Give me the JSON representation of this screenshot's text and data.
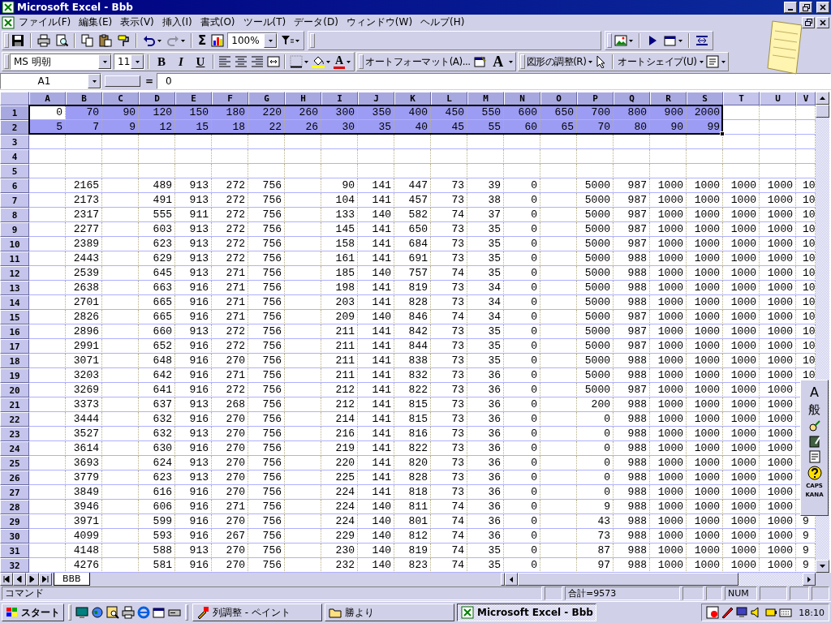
{
  "window": {
    "title": "Microsoft Excel - Bbb"
  },
  "menu_bar": {
    "items": [
      "ファイル(F)",
      "編集(E)",
      "表示(V)",
      "挿入(I)",
      "書式(O)",
      "ツール(T)",
      "データ(D)",
      "ウィンドウ(W)",
      "ヘルプ(H)"
    ]
  },
  "standard_toolbar": {
    "autosum": "Σ",
    "zoom": "100%",
    "redo": {
      "disabled": true
    }
  },
  "formatting_toolbar": {
    "font": "MS 明朝",
    "size": "11",
    "bold": "B",
    "italic": "I",
    "underline": "U",
    "font_color": "A",
    "autoformat": "オートフォーマット(A)...",
    "grow_font": "A",
    "draw": "図形の調整(R)",
    "autoshapes": "オートシェイプ(U)"
  },
  "formula_bar": {
    "name_box": "A1",
    "equals": "=",
    "value": "0"
  },
  "grid": {
    "columns": [
      "A",
      "B",
      "C",
      "D",
      "E",
      "F",
      "G",
      "H",
      "I",
      "J",
      "K",
      "L",
      "M",
      "N",
      "O",
      "P",
      "Q",
      "R",
      "S",
      "T",
      "U",
      "V"
    ],
    "rows": [
      {
        "label": "1",
        "cells": [
          {
            "value": "0",
            "selected": true,
            "active": true
          },
          {
            "value": "70",
            "selected": true,
            "active": false
          },
          {
            "value": "90",
            "selected": true,
            "active": false
          },
          {
            "value": "120",
            "selected": true,
            "active": false
          },
          {
            "value": "150",
            "selected": true,
            "active": false
          },
          {
            "value": "180",
            "selected": true,
            "active": false
          },
          {
            "value": "220",
            "selected": true,
            "active": false
          },
          {
            "value": "260",
            "selected": true,
            "active": false
          },
          {
            "value": "300",
            "selected": true,
            "active": false
          },
          {
            "value": "350",
            "selected": true,
            "active": false
          },
          {
            "value": "400",
            "selected": true,
            "active": false
          },
          {
            "value": "450",
            "selected": true,
            "active": false
          },
          {
            "value": "550",
            "selected": true,
            "active": false
          },
          {
            "value": "600",
            "selected": true,
            "active": false
          },
          {
            "value": "650",
            "selected": true,
            "active": false
          },
          {
            "value": "700",
            "selected": true,
            "active": false
          },
          {
            "value": "800",
            "selected": true,
            "active": false
          },
          {
            "value": "900",
            "selected": true,
            "active": false
          },
          {
            "value": "2000",
            "selected": true,
            "active": false
          }
        ]
      },
      {
        "label": "2",
        "cells": [
          {
            "value": "5",
            "selected": true,
            "active": false
          },
          {
            "value": "7",
            "selected": true,
            "active": false
          },
          {
            "value": "9",
            "selected": true,
            "active": false
          },
          {
            "value": "12",
            "selected": true,
            "active": false
          },
          {
            "value": "15",
            "selected": true,
            "active": false
          },
          {
            "value": "18",
            "selected": true,
            "active": false
          },
          {
            "value": "22",
            "selected": true,
            "active": false
          },
          {
            "value": "26",
            "selected": true,
            "active": false
          },
          {
            "value": "30",
            "selected": true,
            "active": false
          },
          {
            "value": "35",
            "selected": true,
            "active": false
          },
          {
            "value": "40",
            "selected": true,
            "active": false
          },
          {
            "value": "45",
            "selected": true,
            "active": false
          },
          {
            "value": "55",
            "selected": true,
            "active": false
          },
          {
            "value": "60",
            "selected": true,
            "active": false
          },
          {
            "value": "65",
            "selected": true,
            "active": false
          },
          {
            "value": "70",
            "selected": true,
            "active": false
          },
          {
            "value": "80",
            "selected": true,
            "active": false
          },
          {
            "value": "90",
            "selected": true,
            "active": false
          },
          {
            "value": "99",
            "selected": true,
            "active": false
          }
        ]
      },
      {
        "label": "3"
      },
      {
        "label": "4"
      },
      {
        "label": "5"
      },
      {
        "label": "6",
        "cells": [
          null,
          "2165",
          null,
          "489",
          "913",
          "272",
          "756",
          null,
          "90",
          "141",
          "447",
          "73",
          "39",
          "0",
          null,
          "5000",
          "987",
          "1000",
          "1000",
          "1000",
          "1000",
          "10"
        ]
      },
      {
        "label": "7",
        "cells": [
          null,
          "2173",
          null,
          "491",
          "913",
          "272",
          "756",
          null,
          "104",
          "141",
          "457",
          "73",
          "38",
          "0",
          null,
          "5000",
          "987",
          "1000",
          "1000",
          "1000",
          "1000",
          "10"
        ]
      },
      {
        "label": "8",
        "cells": [
          null,
          "2317",
          null,
          "555",
          "911",
          "272",
          "756",
          null,
          "133",
          "140",
          "582",
          "74",
          "37",
          "0",
          null,
          "5000",
          "987",
          "1000",
          "1000",
          "1000",
          "1000",
          "10"
        ]
      },
      {
        "label": "9",
        "cells": [
          null,
          "2277",
          null,
          "603",
          "913",
          "272",
          "756",
          null,
          "145",
          "141",
          "650",
          "73",
          "35",
          "0",
          null,
          "5000",
          "987",
          "1000",
          "1000",
          "1000",
          "1000",
          "10"
        ]
      },
      {
        "label": "10",
        "cells": [
          null,
          "2389",
          null,
          "623",
          "913",
          "272",
          "756",
          null,
          "158",
          "141",
          "684",
          "73",
          "35",
          "0",
          null,
          "5000",
          "987",
          "1000",
          "1000",
          "1000",
          "1000",
          "10"
        ]
      },
      {
        "label": "11",
        "cells": [
          null,
          "2443",
          null,
          "629",
          "913",
          "272",
          "756",
          null,
          "161",
          "141",
          "691",
          "73",
          "35",
          "0",
          null,
          "5000",
          "988",
          "1000",
          "1000",
          "1000",
          "1000",
          "10"
        ]
      },
      {
        "label": "12",
        "cells": [
          null,
          "2539",
          null,
          "645",
          "913",
          "271",
          "756",
          null,
          "185",
          "140",
          "757",
          "74",
          "35",
          "0",
          null,
          "5000",
          "988",
          "1000",
          "1000",
          "1000",
          "1000",
          "10"
        ]
      },
      {
        "label": "13",
        "cells": [
          null,
          "2638",
          null,
          "663",
          "916",
          "271",
          "756",
          null,
          "198",
          "141",
          "819",
          "73",
          "34",
          "0",
          null,
          "5000",
          "988",
          "1000",
          "1000",
          "1000",
          "1000",
          "10"
        ]
      },
      {
        "label": "14",
        "cells": [
          null,
          "2701",
          null,
          "665",
          "916",
          "271",
          "756",
          null,
          "203",
          "141",
          "828",
          "73",
          "34",
          "0",
          null,
          "5000",
          "988",
          "1000",
          "1000",
          "1000",
          "1000",
          "10"
        ]
      },
      {
        "label": "15",
        "cells": [
          null,
          "2826",
          null,
          "665",
          "916",
          "271",
          "756",
          null,
          "209",
          "140",
          "846",
          "74",
          "34",
          "0",
          null,
          "5000",
          "987",
          "1000",
          "1000",
          "1000",
          "1000",
          "10"
        ]
      },
      {
        "label": "16",
        "cells": [
          null,
          "2896",
          null,
          "660",
          "913",
          "272",
          "756",
          null,
          "211",
          "141",
          "842",
          "73",
          "35",
          "0",
          null,
          "5000",
          "987",
          "1000",
          "1000",
          "1000",
          "1000",
          "10"
        ]
      },
      {
        "label": "17",
        "cells": [
          null,
          "2991",
          null,
          "652",
          "916",
          "272",
          "756",
          null,
          "211",
          "141",
          "844",
          "73",
          "35",
          "0",
          null,
          "5000",
          "987",
          "1000",
          "1000",
          "1000",
          "1000",
          "10"
        ]
      },
      {
        "label": "18",
        "cells": [
          null,
          "3071",
          null,
          "648",
          "916",
          "270",
          "756",
          null,
          "211",
          "141",
          "838",
          "73",
          "35",
          "0",
          null,
          "5000",
          "988",
          "1000",
          "1000",
          "1000",
          "1000",
          "10"
        ]
      },
      {
        "label": "19",
        "cells": [
          null,
          "3203",
          null,
          "642",
          "916",
          "271",
          "756",
          null,
          "211",
          "141",
          "832",
          "73",
          "36",
          "0",
          null,
          "5000",
          "988",
          "1000",
          "1000",
          "1000",
          "1000",
          "10"
        ]
      },
      {
        "label": "20",
        "cells": [
          null,
          "3269",
          null,
          "641",
          "916",
          "272",
          "756",
          null,
          "212",
          "141",
          "822",
          "73",
          "36",
          "0",
          null,
          "5000",
          "987",
          "1000",
          "1000",
          "1000",
          "1000"
        ]
      },
      {
        "label": "21",
        "cells": [
          null,
          "3373",
          null,
          "637",
          "913",
          "268",
          "756",
          null,
          "212",
          "141",
          "815",
          "73",
          "36",
          "0",
          null,
          "200",
          "988",
          "1000",
          "1000",
          "1000",
          "1000"
        ]
      },
      {
        "label": "22",
        "cells": [
          null,
          "3444",
          null,
          "632",
          "916",
          "270",
          "756",
          null,
          "214",
          "141",
          "815",
          "73",
          "36",
          "0",
          null,
          "0",
          "988",
          "1000",
          "1000",
          "1000",
          "1000"
        ]
      },
      {
        "label": "23",
        "cells": [
          null,
          "3527",
          null,
          "632",
          "913",
          "270",
          "756",
          null,
          "216",
          "141",
          "816",
          "73",
          "36",
          "0",
          null,
          "0",
          "988",
          "1000",
          "1000",
          "1000",
          "1000"
        ]
      },
      {
        "label": "24",
        "cells": [
          null,
          "3614",
          null,
          "630",
          "916",
          "270",
          "756",
          null,
          "219",
          "141",
          "822",
          "73",
          "36",
          "0",
          null,
          "0",
          "988",
          "1000",
          "1000",
          "1000",
          "1000"
        ]
      },
      {
        "label": "25",
        "cells": [
          null,
          "3693",
          null,
          "624",
          "913",
          "270",
          "756",
          null,
          "220",
          "141",
          "820",
          "73",
          "36",
          "0",
          null,
          "0",
          "988",
          "1000",
          "1000",
          "1000",
          "1000"
        ]
      },
      {
        "label": "26",
        "cells": [
          null,
          "3779",
          null,
          "623",
          "913",
          "270",
          "756",
          null,
          "225",
          "141",
          "828",
          "73",
          "36",
          "0",
          null,
          "0",
          "988",
          "1000",
          "1000",
          "1000",
          "1000"
        ]
      },
      {
        "label": "27",
        "cells": [
          null,
          "3849",
          null,
          "616",
          "916",
          "270",
          "756",
          null,
          "224",
          "141",
          "818",
          "73",
          "36",
          "0",
          null,
          "0",
          "988",
          "1000",
          "1000",
          "1000",
          "1000"
        ]
      },
      {
        "label": "28",
        "cells": [
          null,
          "3946",
          null,
          "606",
          "916",
          "271",
          "756",
          null,
          "224",
          "140",
          "811",
          "74",
          "36",
          "0",
          null,
          "9",
          "988",
          "1000",
          "1000",
          "1000",
          "1000"
        ]
      },
      {
        "label": "29",
        "cells": [
          null,
          "3971",
          null,
          "599",
          "916",
          "270",
          "756",
          null,
          "224",
          "140",
          "801",
          "74",
          "36",
          "0",
          null,
          "43",
          "988",
          "1000",
          "1000",
          "1000",
          "1000",
          "9"
        ]
      },
      {
        "label": "30",
        "cells": [
          null,
          "4099",
          null,
          "593",
          "916",
          "267",
          "756",
          null,
          "229",
          "140",
          "812",
          "74",
          "36",
          "0",
          null,
          "73",
          "988",
          "1000",
          "1000",
          "1000",
          "1000",
          "9"
        ]
      },
      {
        "label": "31",
        "cells": [
          null,
          "4148",
          null,
          "588",
          "913",
          "270",
          "756",
          null,
          "230",
          "140",
          "819",
          "74",
          "35",
          "0",
          null,
          "87",
          "988",
          "1000",
          "1000",
          "1000",
          "1000",
          "9"
        ]
      },
      {
        "label": "32",
        "cells": [
          null,
          "4276",
          null,
          "581",
          "916",
          "270",
          "756",
          null,
          "232",
          "140",
          "823",
          "74",
          "35",
          "0",
          null,
          "97",
          "988",
          "1000",
          "1000",
          "1000",
          "1000",
          "9"
        ]
      }
    ]
  },
  "sheet_tabs": [
    {
      "label": "BBB",
      "selected": true
    }
  ],
  "status_bar": {
    "mode": "コマンド",
    "sum": "合計=9573",
    "num": "NUM"
  },
  "ime_bar": {
    "input_mode": "A",
    "conversion": "般",
    "caps": "CAPS",
    "kana": "KANA"
  },
  "taskbar": {
    "start": "スタート",
    "tasks": [
      {
        "label": "列調整 - ペイント",
        "selected": false
      },
      {
        "label": "勝より",
        "selected": false
      },
      {
        "label": "Microsoft Excel - Bbb",
        "selected": true
      }
    ],
    "clock": "18:10"
  }
}
